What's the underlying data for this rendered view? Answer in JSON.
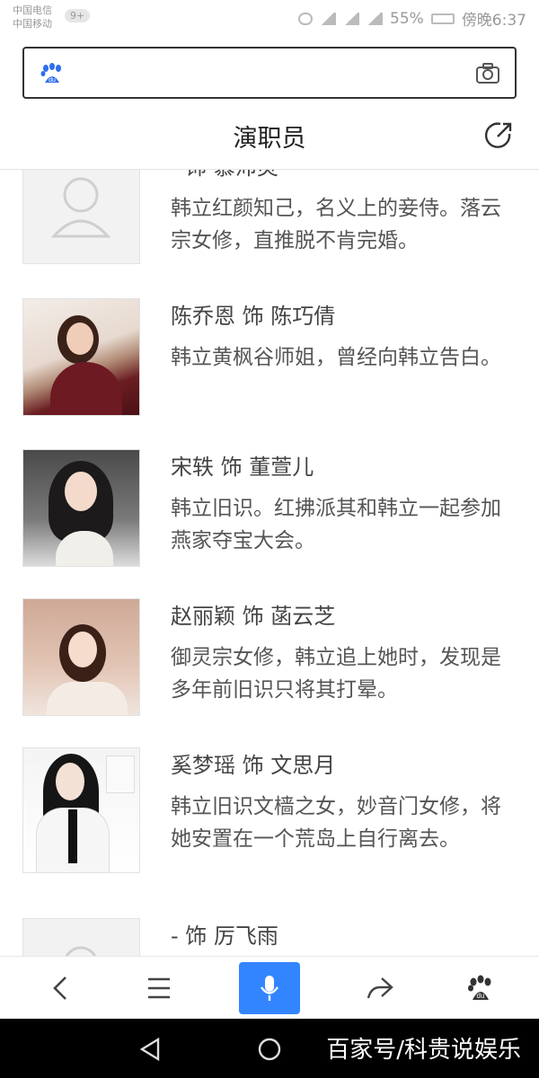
{
  "status": {
    "carrier1": "中国电信",
    "carrier2": "中国移动",
    "badge": "9+",
    "battery": "55%",
    "time": "傍晚6:37"
  },
  "search": {
    "value": ""
  },
  "header": {
    "title": "演职员"
  },
  "cast": [
    {
      "name": "- 饰 慕沛灵",
      "desc": "韩立红颜知己，名义上的妾侍。落云宗女修，直推脱不肯完婚。"
    },
    {
      "name": "陈乔恩  饰 陈巧倩",
      "desc": "韩立黄枫谷师姐，曾经向韩立告白。"
    },
    {
      "name": "宋轶  饰 董萱儿",
      "desc": "韩立旧识。红拂派其和韩立一起参加燕家夺宝大会。"
    },
    {
      "name": "赵丽颖  饰 菡云芝",
      "desc": "御灵宗女修，韩立追上她时，发现是多年前旧识只将其打晕。"
    },
    {
      "name": "奚梦瑶  饰 文思月",
      "desc": "韩立旧识文樯之女，妙音门女修，将她安置在一个荒岛上自行离去。"
    },
    {
      "name": "- 饰 厉飞雨",
      "desc": ""
    }
  ],
  "watermark": "百家号/科贵说娱乐",
  "colors": {
    "accent": "#3385ff"
  },
  "icons": [
    "baidu-logo-icon",
    "camera-icon",
    "share-icon",
    "back-icon",
    "menu-icon",
    "mic-icon",
    "forward-icon",
    "baidu-paw-icon",
    "system-back-icon",
    "system-home-icon"
  ]
}
